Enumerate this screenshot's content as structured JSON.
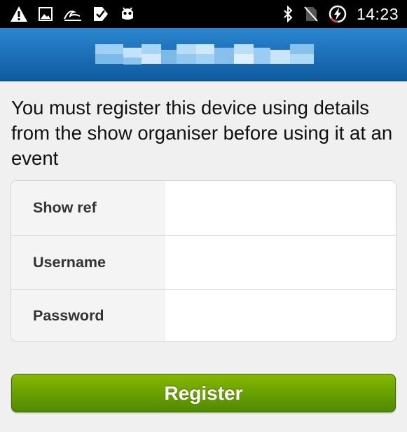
{
  "status_bar": {
    "time": "14:23",
    "left_icons": [
      "warning-icon",
      "image-icon",
      "wave-icon",
      "checkmark-tag-icon",
      "android-robot-icon"
    ],
    "right_icons": [
      "bluetooth-icon",
      "no-sim-icon",
      "battery-charging-icon"
    ]
  },
  "app_bar": {
    "title_pixelated": true,
    "colors": {
      "top": "#2a86cf",
      "bottom": "#0f5aa0"
    }
  },
  "message": "You must register this device using details from the show organiser before using it at an event",
  "form": {
    "fields": [
      {
        "label": "Show ref",
        "value": ""
      },
      {
        "label": "Username",
        "value": ""
      },
      {
        "label": "Password",
        "value": ""
      }
    ]
  },
  "register_button": {
    "label": "Register",
    "color": "#6aa300"
  }
}
